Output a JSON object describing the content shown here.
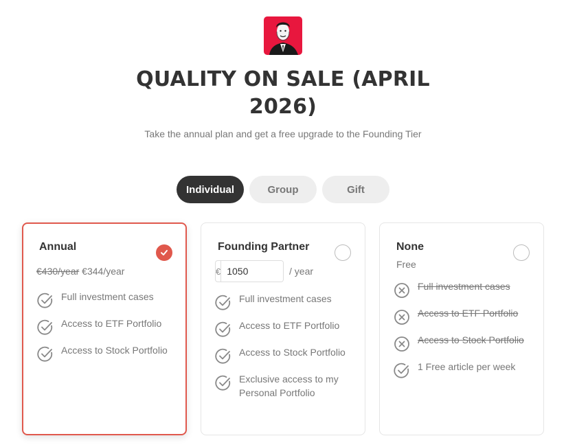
{
  "header": {
    "logo_icon": "author-portrait-icon",
    "title": "QUALITY ON SALE (APRIL 2026)",
    "subtitle": "Take the annual plan and get a free upgrade to the Founding Tier"
  },
  "tabs": [
    {
      "label": "Individual",
      "active": true
    },
    {
      "label": "Group",
      "active": false
    },
    {
      "label": "Gift",
      "active": false
    }
  ],
  "colors": {
    "accent": "#e0584c",
    "dark": "#333333",
    "muted": "#777777"
  },
  "plans": [
    {
      "title": "Annual",
      "selected": true,
      "old_price": "€430/year",
      "new_price": "€344/year",
      "features": [
        {
          "text": "Full investment cases",
          "included": true
        },
        {
          "text": "Access to ETF Portfolio",
          "included": true
        },
        {
          "text": "Access to Stock Portfolio",
          "included": true
        }
      ]
    },
    {
      "title": "Founding Partner",
      "selected": false,
      "currency": "€",
      "amount": "1050",
      "unit": "/ year",
      "features": [
        {
          "text": "Full investment cases",
          "included": true
        },
        {
          "text": "Access to ETF Portfolio",
          "included": true
        },
        {
          "text": "Access to Stock Portfolio",
          "included": true
        },
        {
          "text": "Exclusive access to my Personal Portfolio",
          "included": true
        }
      ]
    },
    {
      "title": "None",
      "selected": false,
      "price_label": "Free",
      "features": [
        {
          "text": "Full investment cases",
          "included": false
        },
        {
          "text": "Access to ETF Portfolio",
          "included": false
        },
        {
          "text": "Access to Stock Portfolio",
          "included": false
        },
        {
          "text": "1 Free article per week",
          "included": true
        }
      ]
    }
  ]
}
